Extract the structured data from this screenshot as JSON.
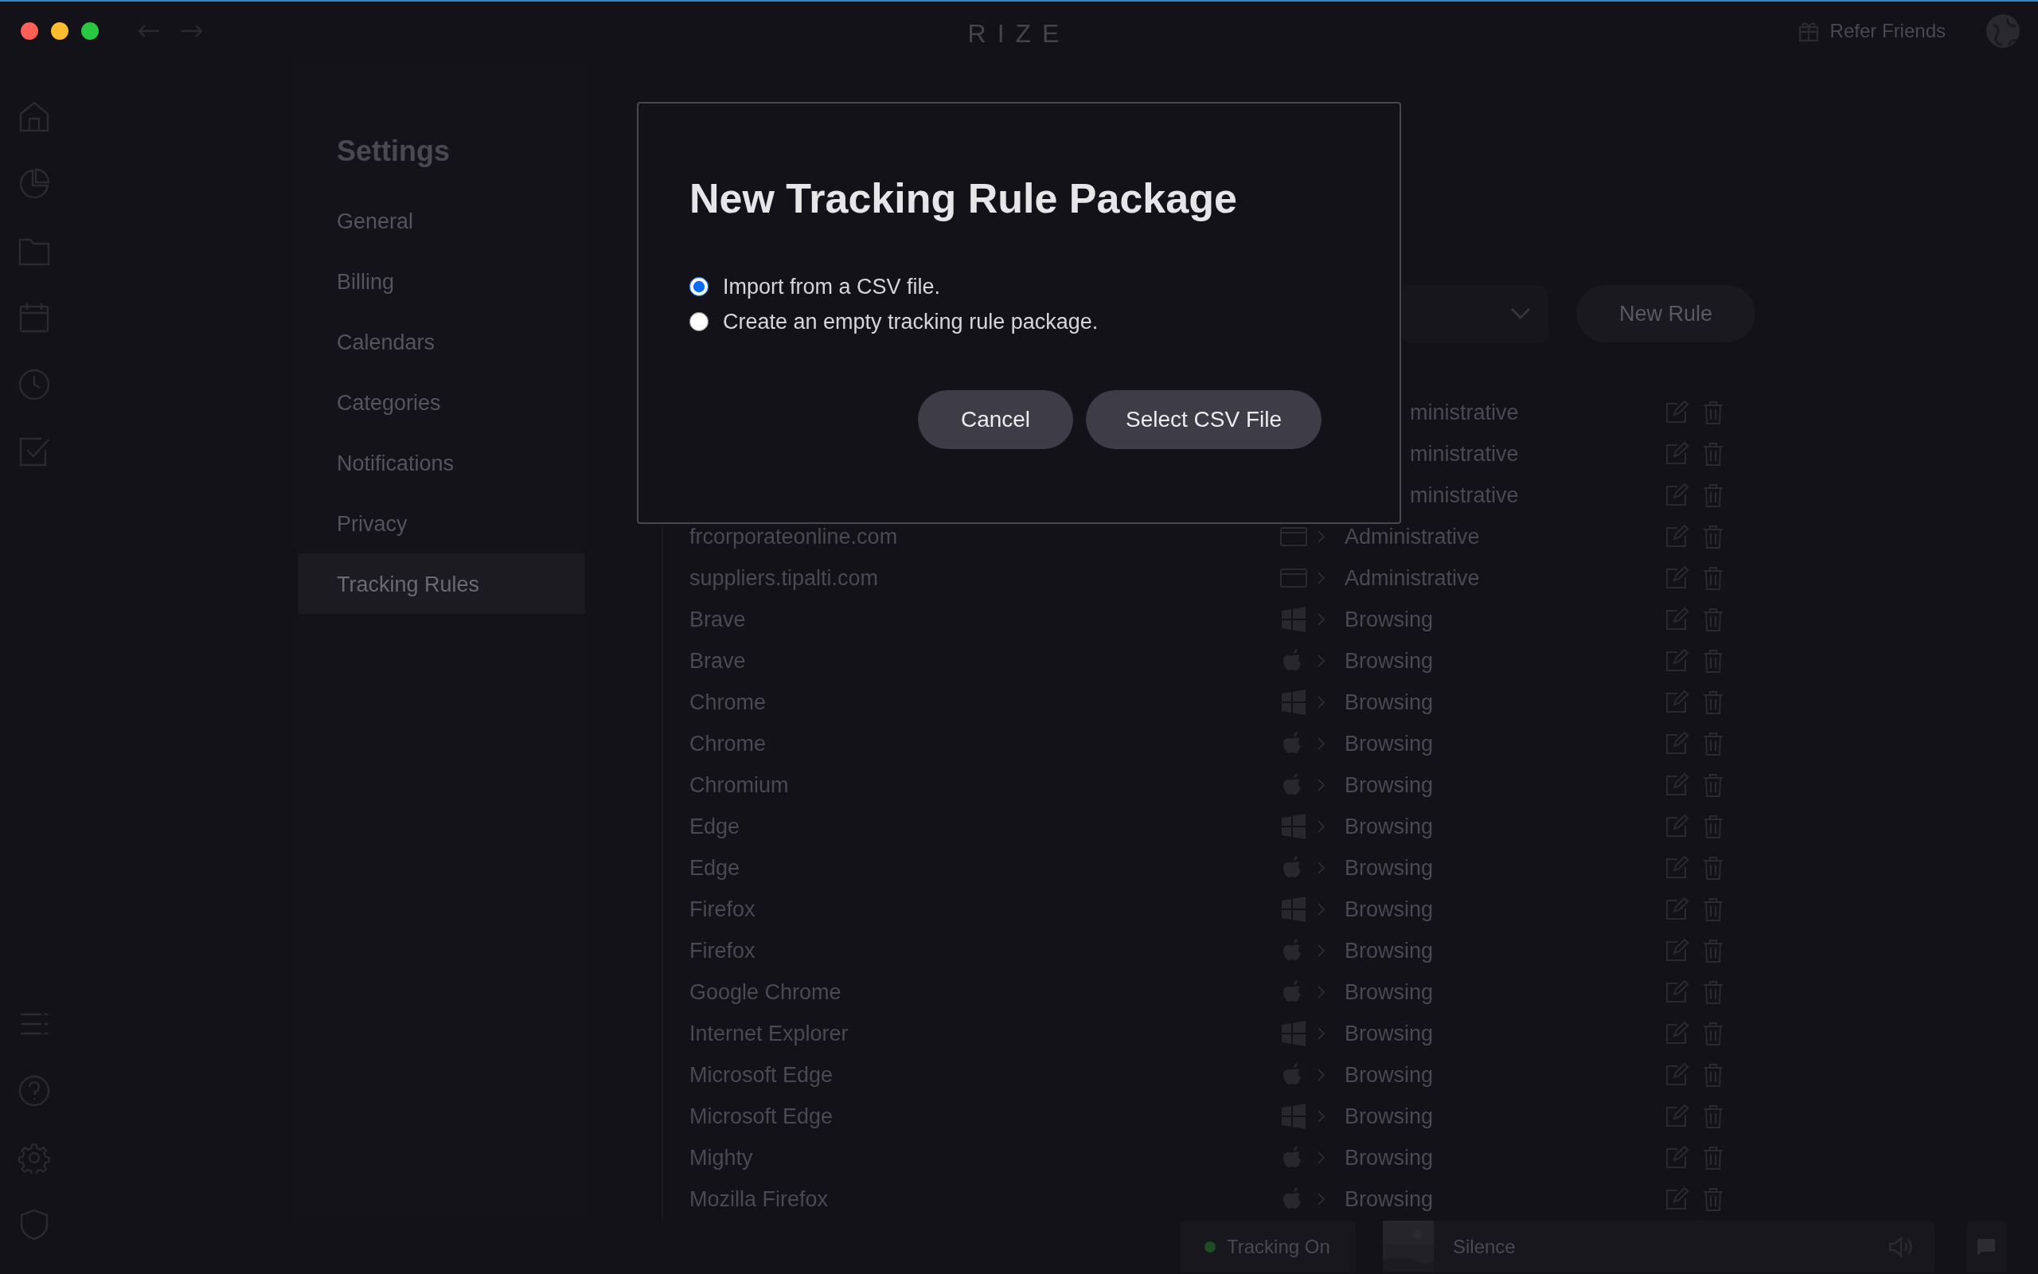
{
  "window": {
    "title": "RIZE"
  },
  "header": {
    "refer_label": "Refer Friends"
  },
  "settings": {
    "title": "Settings",
    "items": [
      {
        "label": "General",
        "selected": false
      },
      {
        "label": "Billing",
        "selected": false
      },
      {
        "label": "Calendars",
        "selected": false
      },
      {
        "label": "Categories",
        "selected": false
      },
      {
        "label": "Notifications",
        "selected": false
      },
      {
        "label": "Privacy",
        "selected": false
      },
      {
        "label": "Tracking Rules",
        "selected": true
      }
    ]
  },
  "toolbar": {
    "new_rule_label": "New Rule"
  },
  "rules": [
    {
      "kind": "partial",
      "category": "ministrative"
    },
    {
      "kind": "partial",
      "category": "ministrative"
    },
    {
      "kind": "partial",
      "category": "ministrative"
    },
    {
      "kind": "web",
      "name": "frcorporateonline.com",
      "category": "Administrative"
    },
    {
      "kind": "web",
      "name": "suppliers.tipalti.com",
      "category": "Administrative"
    },
    {
      "kind": "windows",
      "name": "Brave",
      "category": "Browsing"
    },
    {
      "kind": "apple",
      "name": "Brave",
      "category": "Browsing"
    },
    {
      "kind": "windows",
      "name": "Chrome",
      "category": "Browsing"
    },
    {
      "kind": "apple",
      "name": "Chrome",
      "category": "Browsing"
    },
    {
      "kind": "apple",
      "name": "Chromium",
      "category": "Browsing"
    },
    {
      "kind": "windows",
      "name": "Edge",
      "category": "Browsing"
    },
    {
      "kind": "apple",
      "name": "Edge",
      "category": "Browsing"
    },
    {
      "kind": "windows",
      "name": "Firefox",
      "category": "Browsing"
    },
    {
      "kind": "apple",
      "name": "Firefox",
      "category": "Browsing"
    },
    {
      "kind": "apple",
      "name": "Google Chrome",
      "category": "Browsing"
    },
    {
      "kind": "windows",
      "name": "Internet Explorer",
      "category": "Browsing"
    },
    {
      "kind": "apple",
      "name": "Microsoft Edge",
      "category": "Browsing"
    },
    {
      "kind": "windows",
      "name": "Microsoft Edge",
      "category": "Browsing"
    },
    {
      "kind": "apple",
      "name": "Mighty",
      "category": "Browsing"
    },
    {
      "kind": "apple",
      "name": "Mozilla Firefox",
      "category": "Browsing"
    }
  ],
  "status_bar": {
    "tracking": {
      "label": "Tracking On",
      "on": true
    },
    "music": {
      "label": "Silence"
    }
  },
  "dialog": {
    "title": "New Tracking Rule Package",
    "options": [
      {
        "label": "Import from a CSV file.",
        "selected": true
      },
      {
        "label": "Create an empty tracking rule package.",
        "selected": false
      }
    ],
    "buttons": [
      {
        "label": "Cancel"
      },
      {
        "label": "Select CSV File"
      }
    ]
  }
}
